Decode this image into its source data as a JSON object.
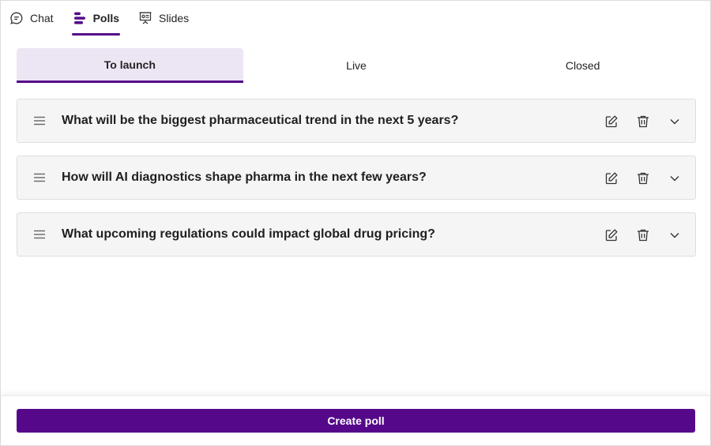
{
  "tabs": [
    {
      "label": "Chat",
      "icon": "chat-bubble-icon",
      "active": false
    },
    {
      "label": "Polls",
      "icon": "polls-icon",
      "active": true
    },
    {
      "label": "Slides",
      "icon": "slides-icon",
      "active": false
    }
  ],
  "poll_states": [
    {
      "label": "To launch",
      "active": true
    },
    {
      "label": "Live",
      "active": false
    },
    {
      "label": "Closed",
      "active": false
    }
  ],
  "polls": [
    {
      "question": "What will be the biggest pharmaceutical trend in the next 5 years?"
    },
    {
      "question": "How will AI diagnostics shape pharma in the next few years?"
    },
    {
      "question": "What upcoming regulations could impact global drug pricing?"
    }
  ],
  "footer": {
    "create_label": "Create poll"
  },
  "colors": {
    "accent": "#55098a",
    "active_tab_bg": "#ece5f3",
    "card_bg": "#f5f5f5"
  }
}
